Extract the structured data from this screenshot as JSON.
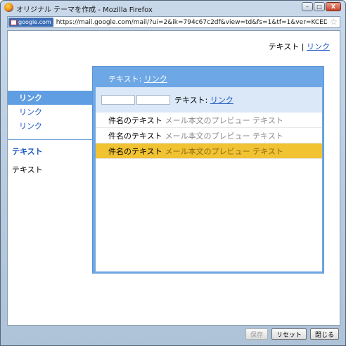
{
  "window": {
    "title": "オリジナル テーマを作成 - Mozilla Firefox",
    "controls": {
      "minimize": "–",
      "maximize": "□",
      "close": "X"
    }
  },
  "urlbar": {
    "site_badge": "google.com",
    "url": "https://mail.google.com/mail/?ui=2&ik=794c67c2df&view=td&fs=1&tf=1&ver=KCED7TickOs.ja.&am=!Vc_JqYIUDIy7Av"
  },
  "top_links": {
    "text": "テキスト",
    "separator": " | ",
    "link": "リンク"
  },
  "sidebar": {
    "items": [
      {
        "label": "リンク",
        "active": true
      },
      {
        "label": "リンク",
        "active": false
      },
      {
        "label": "リンク",
        "active": false
      }
    ],
    "section_blue": "テキスト",
    "section_plain": "テキスト"
  },
  "panel": {
    "header_text": "テキスト: ",
    "header_link": "リンク",
    "toolbar_text": "テキスト: ",
    "toolbar_link": "リンク",
    "messages": [
      {
        "subject": "件名のテキスト",
        "preview": "メール本文のプレビュー テキスト",
        "selected": false
      },
      {
        "subject": "件名のテキスト",
        "preview": "メール本文のプレビュー テキスト",
        "selected": false
      },
      {
        "subject": "件名のテキスト",
        "preview": "メール本文のプレビュー テキスト",
        "selected": true
      }
    ]
  },
  "buttons": {
    "save": "保存",
    "reset": "リセット",
    "close": "閉じる"
  },
  "colors": {
    "accent": "#5f9ee3",
    "panel": "#6ea7e6",
    "selected_row": "#f1c232",
    "link": "#1a55c4"
  }
}
